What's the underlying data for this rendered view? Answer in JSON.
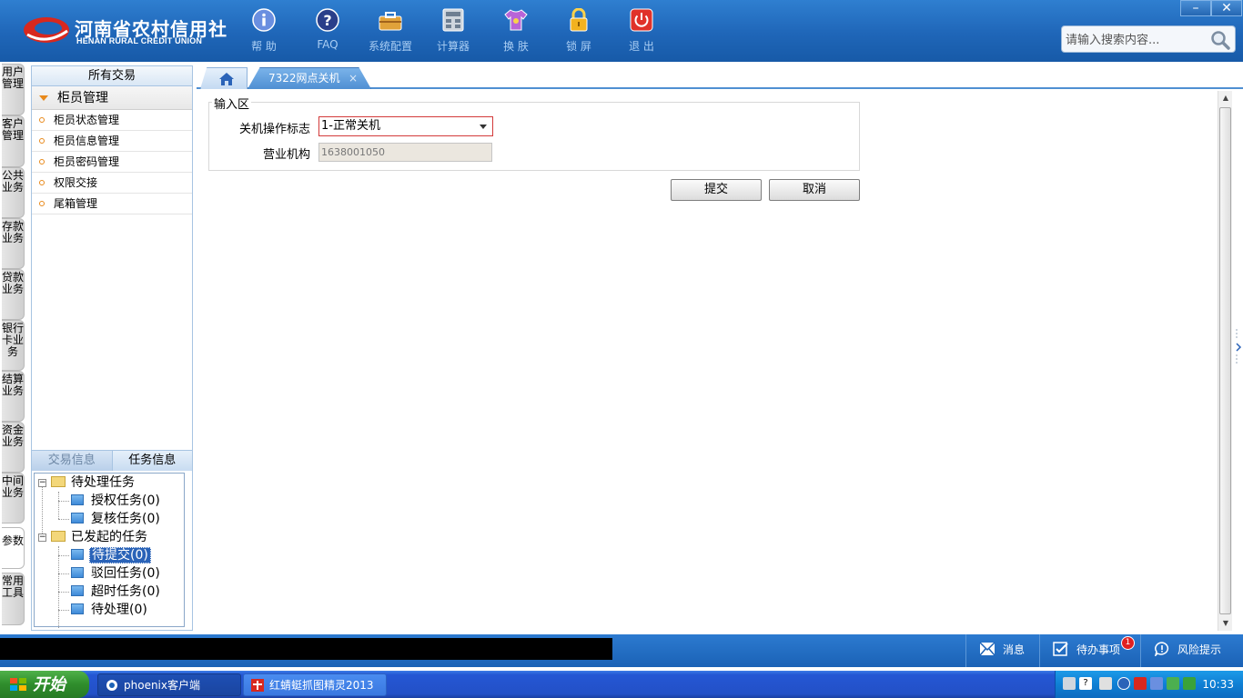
{
  "header": {
    "logo_cn": "河南省农村信用社",
    "logo_en": "HENAN RURAL CREDIT UNION",
    "tools": [
      {
        "label": "帮 助",
        "icon": "info-icon"
      },
      {
        "label": "FAQ",
        "icon": "help-question-icon"
      },
      {
        "label": "系统配置",
        "icon": "toolbox-icon"
      },
      {
        "label": "计算器",
        "icon": "calculator-icon"
      },
      {
        "label": "换 肤",
        "icon": "tshirt-icon"
      },
      {
        "label": "锁 屏",
        "icon": "lock-icon"
      },
      {
        "label": "退 出",
        "icon": "power-icon"
      }
    ],
    "window_controls": {
      "minimize": "–",
      "close": "✕"
    },
    "search_placeholder": "请输入搜索内容..."
  },
  "vertical_tabs": [
    "用户管理",
    "客户管理",
    "公共业务",
    "存款业务",
    "贷款业务",
    "银行卡业务",
    "结算业务",
    "资金业务",
    "中间业务",
    "参数",
    "常用工具"
  ],
  "left_panel": {
    "title": "所有交易",
    "group": "柜员管理",
    "items": [
      "柜员状态管理",
      "柜员信息管理",
      "柜员密码管理",
      "权限交接",
      "尾箱管理"
    ],
    "bottom_tabs": [
      "交易信息",
      "任务信息"
    ],
    "tree": {
      "pending": {
        "label": "待处理任务",
        "children": [
          "授权任务(0)",
          "复核任务(0)"
        ]
      },
      "initiated": {
        "label": "已发起的任务",
        "children": [
          "待提交(0)",
          "驳回任务(0)",
          "超时任务(0)",
          "待处理(0)"
        ]
      }
    }
  },
  "tabs": {
    "active_label": "7322网点关机",
    "close": "×"
  },
  "form": {
    "legend": "输入区",
    "shutdown_label": "关机操作标志",
    "shutdown_value": "1-正常关机",
    "org_label": "营业机构",
    "org_value": "1638001050",
    "submit": "提交",
    "cancel": "取消"
  },
  "statusbar": {
    "messages": "消息",
    "todo": "待办事项",
    "todo_badge": "1",
    "risk": "风险提示"
  },
  "taskbar": {
    "start": "开始",
    "buttons": [
      "phoenix客户端",
      "红蜻蜓抓图精灵2013"
    ],
    "clock": "10:33"
  },
  "colors": {
    "header_blue": "#1f66b8",
    "active_tab": "#4f8fd2",
    "selected_node": "#2a63b8",
    "required_border": "#d33a3a",
    "badge": "#e02020"
  }
}
